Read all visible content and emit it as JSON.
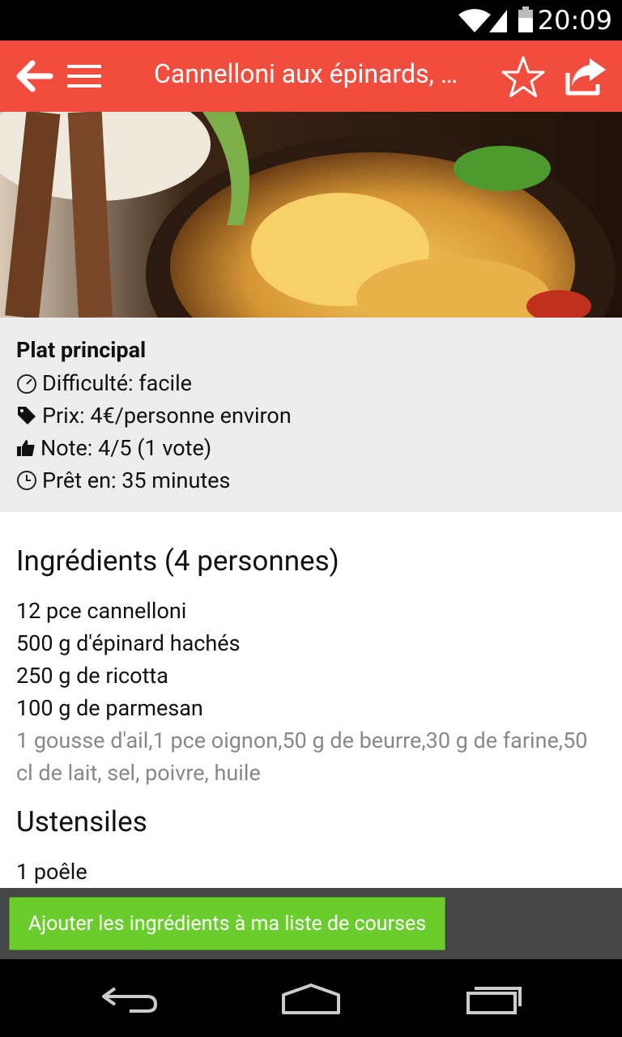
{
  "status": {
    "time": "20:09",
    "wifi_icon": "wifi-icon",
    "signal_icon": "signal-icon",
    "battery_icon": "battery-icon"
  },
  "appbar": {
    "title": "Cannelloni aux épinards, …",
    "back_icon": "arrow-left-icon",
    "menu_icon": "hamburger-menu-icon",
    "favorite_icon": "star-outline-icon",
    "share_icon": "share-icon",
    "color": "#f14d3e"
  },
  "recipe": {
    "category": "Plat principal",
    "difficulty": "Difficulté: facile",
    "price": "Prix: 4€/personne environ",
    "rating": "Note: 4/5 (1 vote)",
    "ready_in": "Prêt en: 35 minutes"
  },
  "ingredients": {
    "heading": "Ingrédients (4 personnes)",
    "items": [
      "12 pce cannelloni",
      "500 g d'épinard hachés",
      "250 g de ricotta",
      "100 g de parmesan"
    ],
    "extra": "1 gousse d'ail,1 pce oignon,50 g de beurre,30 g de farine,50 cl de lait, sel, poivre, huile"
  },
  "utensils": {
    "heading": "Ustensiles",
    "items": [
      "1 poêle"
    ]
  },
  "actions": {
    "add_to_list": "Ajouter les ingrédients à ma liste de courses",
    "button_color": "#6bcc2e"
  },
  "navbar": {
    "back_icon": "nav-back-icon",
    "home_icon": "nav-home-icon",
    "recents_icon": "nav-recents-icon"
  }
}
